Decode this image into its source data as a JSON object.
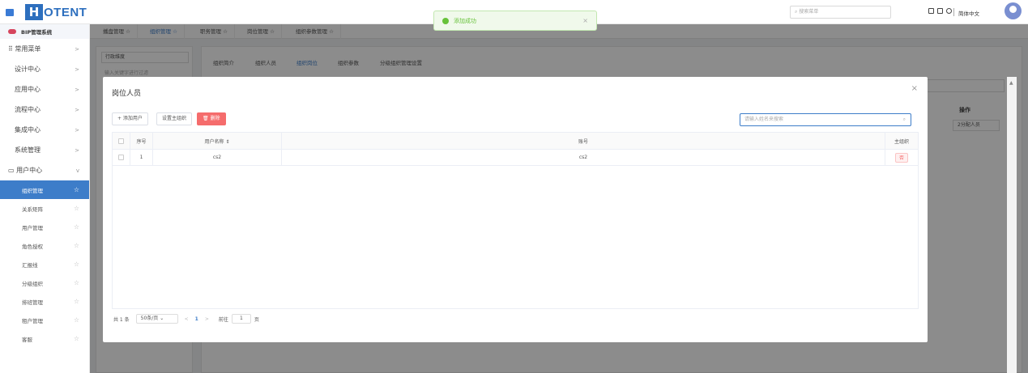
{
  "header": {
    "logo_letter": "H",
    "logo_text": "OTENT",
    "search_placeholder": "搜索菜单",
    "language": "简体中文"
  },
  "toast": {
    "message": "添加成功",
    "close": "×"
  },
  "sidebar": {
    "system_name": "BIP管理系统",
    "sections": [
      {
        "label": "常用菜单",
        "chev": ">"
      },
      {
        "label": "设计中心",
        "chev": ">"
      },
      {
        "label": "应用中心",
        "chev": ">"
      },
      {
        "label": "流程中心",
        "chev": ">"
      },
      {
        "label": "集成中心",
        "chev": ">"
      },
      {
        "label": "系统管理",
        "chev": ">"
      },
      {
        "label": "用户中心",
        "chev": "v"
      }
    ],
    "sub_items": [
      {
        "label": "组织管理",
        "active": true
      },
      {
        "label": "关系矩阵"
      },
      {
        "label": "用户管理"
      },
      {
        "label": "角色授权"
      },
      {
        "label": "汇报线"
      },
      {
        "label": "分级组织"
      },
      {
        "label": "排班管理"
      },
      {
        "label": "租户管理"
      },
      {
        "label": "客服"
      }
    ]
  },
  "tabs": [
    {
      "label": "播盘管理 ☆"
    },
    {
      "label": "组织管理 ☆",
      "active": true
    },
    {
      "label": "职务管理 ☆"
    },
    {
      "label": "岗位管理 ☆"
    },
    {
      "label": "组织参数管理 ☆"
    }
  ],
  "background": {
    "tree_select": "行政维度",
    "tree_input": "输入关键字进行过滤",
    "inner_tabs": [
      "组织简介",
      "组织人员",
      "组织岗位",
      "组织参数",
      "分级组织管理设置"
    ],
    "op_header": "操作",
    "assign_label": "2分配人员"
  },
  "dialog": {
    "title": "岗位人员",
    "close": "×",
    "buttons": {
      "add_user": "+ 添加用户",
      "set_main_org": "设置主组织",
      "delete": "删除"
    },
    "search_placeholder": "请输入姓名来搜索",
    "table": {
      "columns": [
        "序号",
        "用户名称 ⇕",
        "账号",
        "主组织"
      ],
      "rows": [
        {
          "index": "1",
          "username": "cs2",
          "account": "cs2",
          "main_org": "否"
        }
      ]
    },
    "pager": {
      "total": "共 1 条",
      "page_size": "50条/页",
      "prev": "<",
      "page": "1",
      "next": ">",
      "goto_label": "前往",
      "goto_value": "1",
      "unit": "页"
    }
  }
}
